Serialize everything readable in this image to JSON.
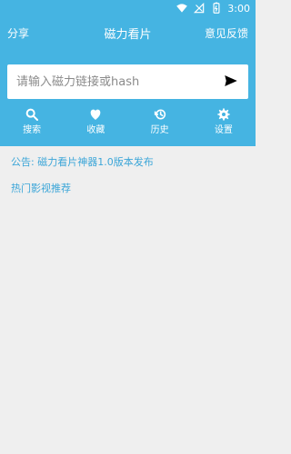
{
  "status_bar": {
    "time": "3:00",
    "icons": [
      "wifi-icon",
      "signal-icon",
      "battery-icon"
    ]
  },
  "top_bar": {
    "share_label": "分享",
    "title": "磁力看片",
    "feedback_label": "意见反馈"
  },
  "search": {
    "placeholder": "请输入磁力链接或hash",
    "value": "",
    "send_icon": "send-icon"
  },
  "tabs": [
    {
      "label": "搜索",
      "icon": "search-icon"
    },
    {
      "label": "收藏",
      "icon": "heart-icon"
    },
    {
      "label": "历史",
      "icon": "history-icon"
    },
    {
      "label": "设置",
      "icon": "gear-icon"
    }
  ],
  "main": {
    "announcement": "公告: 磁力看片神器1.0版本发布",
    "hot_recommend": "热门影视推荐"
  },
  "colors": {
    "accent": "#45B4E2",
    "link": "#3CA6D8",
    "background": "#EFEFEF"
  }
}
